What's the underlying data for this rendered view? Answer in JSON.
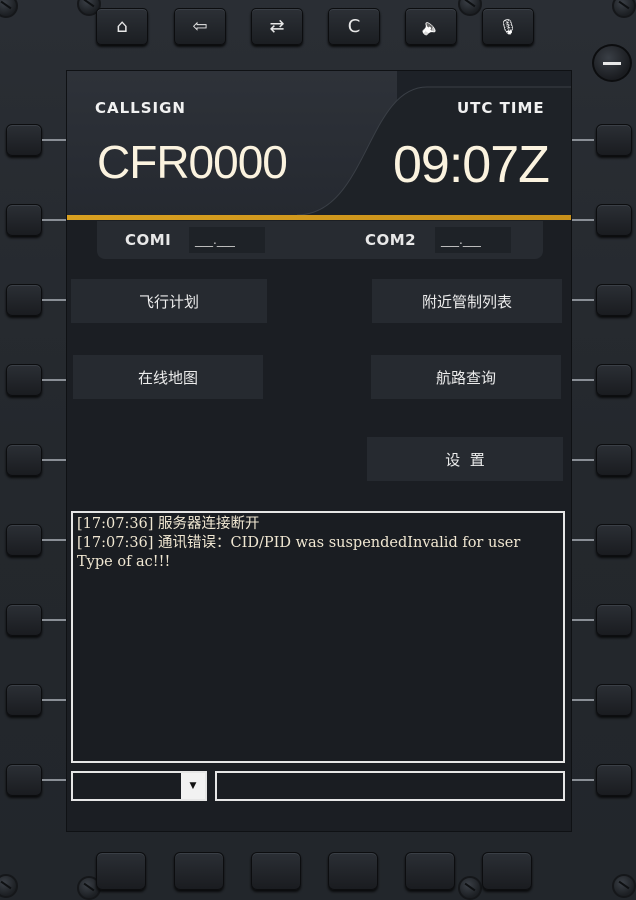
{
  "toolbar": {
    "home_icon": "⌂",
    "back_icon": "⇦",
    "swap_icon": "⇄",
    "clear_label": "C",
    "speaker_icon": "🔈",
    "mic_icon": "🎙"
  },
  "header": {
    "callsign_label": "CALLSIGN",
    "callsign_value": "CFR0000",
    "utc_label": "UTC TIME",
    "utc_value": "09:07Z"
  },
  "com": {
    "com1_label": "COMI",
    "com1_value": "___.___",
    "com2_label": "COM2",
    "com2_value": "___.___"
  },
  "menu": {
    "flight_plan": "飞行计划",
    "nearby_atc": "附近管制列表",
    "online_map": "在线地图",
    "route_query": "航路查询",
    "settings": "设  置"
  },
  "log": {
    "lines": "[17:07:36] 服务器连接断开\n[17:07:36] 通讯错误：CID/PID was suspendedInvalid for user Type of ac!!!"
  },
  "input": {
    "select_value": "",
    "text_value": ""
  },
  "colors": {
    "accent_gold": "#d9a020",
    "screen_bg": "#1b1e23",
    "button_bg": "#262a30",
    "text_cream": "#fbf3df"
  }
}
